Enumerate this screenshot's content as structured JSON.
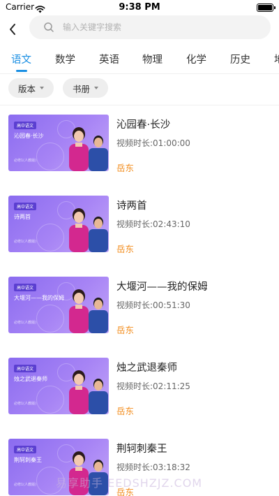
{
  "status_bar": {
    "carrier": "Carrier",
    "time": "9:38 PM"
  },
  "search": {
    "placeholder": "输入关键字搜索"
  },
  "tabs": [
    {
      "label": "语文",
      "active": true
    },
    {
      "label": "数学"
    },
    {
      "label": "英语"
    },
    {
      "label": "物理"
    },
    {
      "label": "化学"
    },
    {
      "label": "历史"
    },
    {
      "label": "地"
    }
  ],
  "filters": {
    "edition": "版本",
    "book": "书册"
  },
  "courses": [
    {
      "thumb_badge": "高中语文",
      "thumb_title": "沁园春·长沙",
      "thumb_sub": "必修1(人教版)",
      "title": "沁园春·长沙",
      "duration": "视频时长:01:00:00",
      "teacher": "岳东"
    },
    {
      "thumb_badge": "高中语文",
      "thumb_title": "诗两首",
      "thumb_sub": "必修1(人教版)",
      "title": "诗两首",
      "duration": "视频时长:02:43:10",
      "teacher": "岳东"
    },
    {
      "thumb_badge": "高中语文",
      "thumb_title": "大堰河——我的保姆",
      "thumb_sub": "必修1(人教版)",
      "title": "大堰河——我的保姆",
      "duration": "视频时长:00:51:30",
      "teacher": "岳东"
    },
    {
      "thumb_badge": "高中语文",
      "thumb_title": "烛之武退秦师",
      "thumb_sub": "必修1(人教版)",
      "title": "烛之武退秦师",
      "duration": "视频时长:02:11:25",
      "teacher": "岳东"
    },
    {
      "thumb_badge": "高中语文",
      "thumb_title": "荆轲刺秦王",
      "thumb_sub": "必修1(人教版)",
      "title": "荆轲刺秦王",
      "duration": "视频时长:03:18:32",
      "teacher": "岳东"
    }
  ],
  "watermark": "易享助手 EEDSHZJZ.COM",
  "colors": {
    "accent": "#1a8fe3",
    "teacher": "#f28c1c",
    "thumb": "#9b7bf2"
  }
}
